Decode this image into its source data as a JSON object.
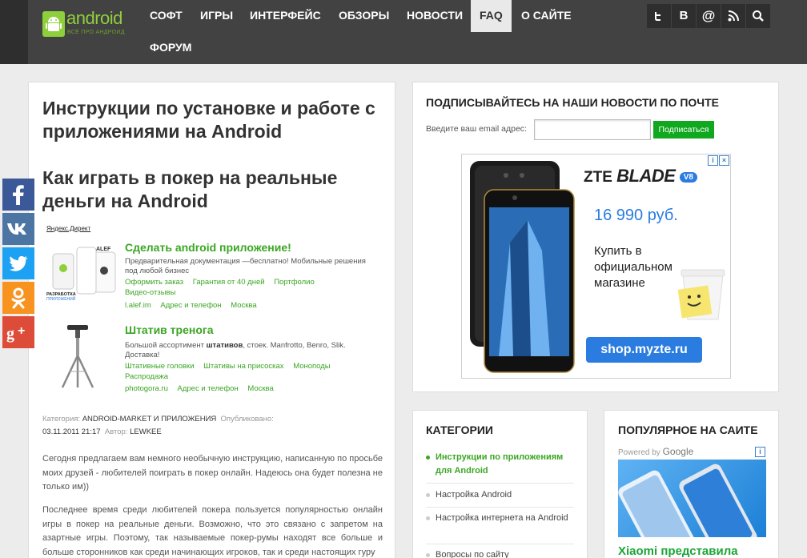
{
  "header": {
    "logo_main": "android",
    "logo_sub": "ВСЁ ПРО АНДРОИД",
    "nav": [
      {
        "label": "СОФТ"
      },
      {
        "label": "ИГРЫ"
      },
      {
        "label": "ИНТЕРФЕЙС"
      },
      {
        "label": "ОБЗОРЫ"
      },
      {
        "label": "НОВОСТИ"
      },
      {
        "label": "FAQ",
        "active": true
      },
      {
        "label": "О САЙТЕ"
      },
      {
        "label": "ФОРУМ"
      }
    ],
    "social_icons": [
      "twitter-icon",
      "vk-icon",
      "email-icon",
      "rss-icon",
      "search-icon"
    ]
  },
  "article": {
    "category_heading": "Инструкции по установке и работе с приложениями на Android",
    "title": "Как играть в покер на реальные деньги на Android",
    "ads_label": "Яндекс.Директ",
    "ads": [
      {
        "title": "Сделать android приложение!",
        "desc": "Предварительная документация —бесплатно! Мобильные решения под любой бизнес",
        "links_row1": [
          "Оформить заказ",
          "Гарантия от 40 дней",
          "Портфолио"
        ],
        "links_row2": [
          "Видео-отзывы"
        ],
        "links_row3": [
          "l.alef.im",
          "Адрес и телефон",
          "Москва"
        ]
      },
      {
        "title": "Штатив тренога",
        "desc_pre": "Большой ассортимент ",
        "desc_bold": "штативов",
        "desc_post": ", стоек. Manfrotto, Benro, Slik. Доставка!",
        "links_row1": [
          "Штативные головки",
          "Штативы на присосках",
          "Моноподы"
        ],
        "links_row2": [
          "Распродажа"
        ],
        "links_row3": [
          "photogora.ru",
          "Адрес и телефон",
          "Москва"
        ]
      }
    ],
    "meta": {
      "category_label": "Категория:",
      "category": "ANDROID-MARKET И ПРИЛОЖЕНИЯ",
      "published_label": "Опубликовано:",
      "published": "03.11.2011 21:17",
      "author_label": "Автор:",
      "author": "LEWKEE"
    },
    "paragraphs": [
      "Сегодня предлагаем вам немного необычную инструкцию, написанную по просьбе моих друзей - любителей поиграть в покер онлайн. Надеюсь она будет полезна не только им))",
      "Последнее время среди любителей покера пользуется популярностью онлайн игры в покер на реальные деньги. Возможно, что это связано с запретом на азартные игры. Поэтому, так называемые покер-румы находят все больше и больше сторонников как среди начинающих игроков, так и среди настоящих гуру"
    ]
  },
  "share": [
    "facebook-icon",
    "vk-icon",
    "twitter-icon",
    "odnoklassniki-icon",
    "google-plus-icon"
  ],
  "subscribe": {
    "title": "ПОДПИСЫВАЙТЕСЬ НА НАШИ НОВОСТИ ПО ПОЧТЕ",
    "label": "Введите ваш email адрес:",
    "email_value": "",
    "button": "Подписаться",
    "ad": {
      "brand": "ZTE",
      "model": "BLADE",
      "model_tag": "V8",
      "price": "16 990 руб.",
      "text": "Купить в официальном магазине",
      "url": "shop.myzte.ru"
    }
  },
  "categories": {
    "title": "КАТЕГОРИИ",
    "items": [
      {
        "label": "Инструкции по приложениям для Android",
        "active": true
      },
      {
        "label": "Настройка Android"
      },
      {
        "label": "Настройка интернета на Android"
      },
      {
        "label": "Вопросы по сайту"
      }
    ]
  },
  "popular": {
    "title": "ПОПУЛЯРНОЕ НА САИТЕ",
    "powered": "Powered by",
    "powered_brand": "Google",
    "item_title": "Xiaomi представила"
  },
  "colors": {
    "header_bg": "#2e2e2e",
    "nav_bg": "#424242",
    "accent_green": "#3aa623",
    "button_green": "#10a81e"
  }
}
